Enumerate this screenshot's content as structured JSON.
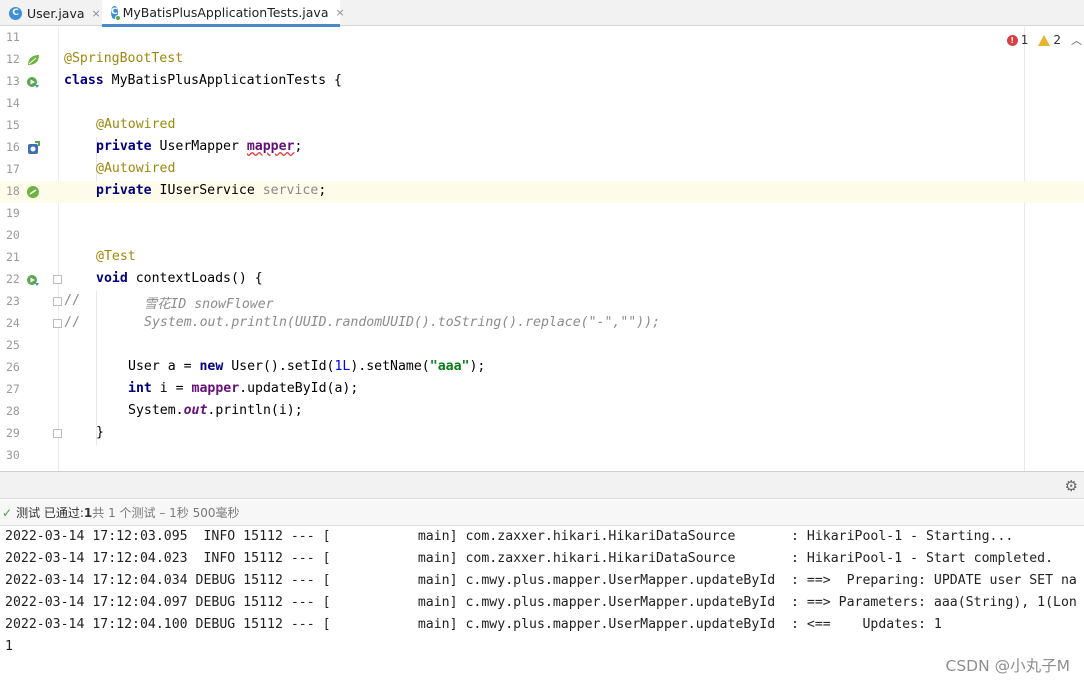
{
  "tabs": [
    {
      "label": "User.java",
      "icon": "java-class-icon",
      "close": "×"
    },
    {
      "label": "MyBatisPlusApplicationTests.java",
      "icon": "java-test-class-icon",
      "close": "×"
    }
  ],
  "inspections": {
    "errors": "1",
    "warnings": "2"
  },
  "editor": {
    "line_numbers": [
      "11",
      "12",
      "13",
      "14",
      "15",
      "16",
      "17",
      "18",
      "19",
      "20",
      "21",
      "22",
      "23",
      "24",
      "25",
      "26",
      "27",
      "28",
      "29",
      "30"
    ],
    "l12": {
      "annotation": "@SpringBootTest"
    },
    "l13": {
      "kw": "class",
      "name": " MyBatisPlusApplicationTests {"
    },
    "l15": {
      "annotation": "@Autowired"
    },
    "l16": {
      "kw": "private",
      "type": " UserMapper ",
      "field": "mapper",
      "end": ";"
    },
    "l17": {
      "annotation": "@Autowired"
    },
    "l18": {
      "kw": "private",
      "type": " IUserService ",
      "field": "service",
      "end": ";"
    },
    "l21": {
      "annotation": "@Test"
    },
    "l22": {
      "kw": "void",
      "rest": " contextLoads() {"
    },
    "l23": {
      "prefix": "//",
      "comment": "雪花ID snowFlower"
    },
    "l24": {
      "prefix": "//",
      "comment": "System.out.println(UUID.randomUUID().toString().replace(\"-\",\"\"));"
    },
    "l26": {
      "a": "User a = ",
      "kw": "new",
      "b": " User().setId(",
      "num": "1L",
      "c": ").setName(",
      "str": "\"aaa\"",
      "d": ");"
    },
    "l27": {
      "kw": "int",
      "a": " i = ",
      "field": "mapper",
      "b": ".updateById(a);"
    },
    "l28": {
      "a": "System.",
      "static": "out",
      "b": ".println(i);"
    },
    "l29": {
      "brace": "}"
    }
  },
  "run_panel": {
    "status_prefix": "测试 已通过: ",
    "passed": "1",
    "status_rest": "共 1 个测试 – 1秒 500毫秒",
    "console_lines": [
      "2022-03-14 17:12:03.095  INFO 15112 --- [           main] com.zaxxer.hikari.HikariDataSource       : HikariPool-1 - Starting...",
      "2022-03-14 17:12:04.023  INFO 15112 --- [           main] com.zaxxer.hikari.HikariDataSource       : HikariPool-1 - Start completed.",
      "2022-03-14 17:12:04.034 DEBUG 15112 --- [           main] c.mwy.plus.mapper.UserMapper.updateById  : ==>  Preparing: UPDATE user SET na",
      "2022-03-14 17:12:04.097 DEBUG 15112 --- [           main] c.mwy.plus.mapper.UserMapper.updateById  : ==> Parameters: aaa(String), 1(Lon",
      "2022-03-14 17:12:04.100 DEBUG 15112 --- [           main] c.mwy.plus.mapper.UserMapper.updateById  : <==    Updates: 1",
      "1"
    ]
  },
  "watermark": "CSDN @小丸子M",
  "colors": {
    "accent": "#4a88c7",
    "annotation": "#9e880d",
    "keyword": "#000080",
    "string": "#067d17",
    "error": "#d94141",
    "warning": "#e6b42d"
  }
}
